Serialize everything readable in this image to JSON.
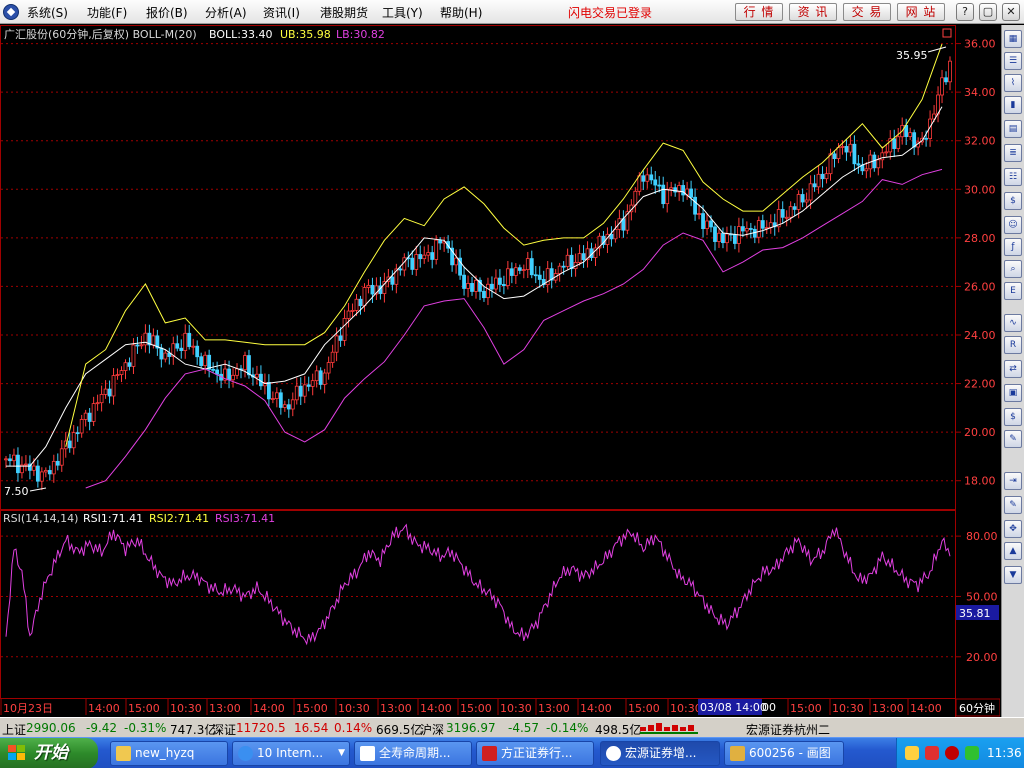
{
  "menu": {
    "items": [
      "系统(S)",
      "功能(F)",
      "报价(B)",
      "分析(A)",
      "资讯(I)",
      "港股期货",
      "工具(Y)",
      "帮助(H)"
    ],
    "login_status": "闪电交易已登录",
    "nav_buttons": [
      "行 情",
      "资 讯",
      "交 易",
      "网 站"
    ],
    "window_controls": [
      "?",
      "_",
      "▢",
      "✕"
    ]
  },
  "price_panel": {
    "title": "广汇股份(60分钟,后复权) BOLL-M(20)",
    "boll_label": "BOLL:33.40",
    "ub_label": "UB:35.98",
    "lb_label": "LB:30.82",
    "high_marker": "35.95",
    "low_marker": "7.50",
    "y_ticks": [
      "36.00",
      "34.00",
      "32.00",
      "30.00",
      "28.00",
      "26.00",
      "24.00",
      "22.00",
      "20.00",
      "18.00"
    ]
  },
  "rsi_panel": {
    "title": "RSI(14,14,14)",
    "rsi1_label": "RSI1:71.41",
    "rsi2_label": "RSI2:71.41",
    "rsi3_label": "RSI3:71.41",
    "y_ticks": [
      "80.00",
      "50.00",
      "20.00"
    ],
    "cursor_value": "35.81"
  },
  "x_axis": {
    "labels": [
      "10月23日",
      "14:00",
      "15:00",
      "10:30",
      "13:00",
      "14:00",
      "15:00",
      "10:30",
      "13:00",
      "14:00",
      "15:00",
      "10:30",
      "13:00",
      "14:00",
      "15:00",
      "10:30",
      "13:00",
      "14:00",
      "15:00",
      "10:30",
      "13:00",
      "14:00"
    ],
    "cursor_label": "03/08 14:00",
    "cursor_label_tail": "00",
    "period": "60分钟"
  },
  "statusbar": {
    "sh_label": "上证",
    "sh_value": "2990.06",
    "sh_change": "-9.42",
    "sh_pct": "-0.31%",
    "sh_amount": "747.3亿",
    "sz_label": "深证",
    "sz_value": "11720.5",
    "sz_change": "16.54",
    "sz_pct": "0.14%",
    "sz_amount": "669.5亿",
    "hs_label": "沪深",
    "hs_value": "3196.97",
    "hs_change": "-4.57",
    "hs_pct": "-0.14%",
    "hs_amount": "498.5亿",
    "broker": "宏源证券杭州二"
  },
  "taskbar": {
    "start": "开始",
    "tasks": [
      "new_hyzq",
      "10 Intern...",
      "全寿命周期...",
      "方正证券行...",
      "宏源证券增...",
      "600256 - 画图"
    ],
    "clock": "11:36"
  },
  "colors": {
    "up": "#ff3b3b",
    "down": "#40d0ff",
    "boll_mid": "#ffffff",
    "boll_upper": "#ffff40",
    "boll_lower": "#e040e0",
    "rsi": "#e040e0",
    "grid": "#a00000"
  },
  "chart_data": {
    "type": "candlestick",
    "price_ylim": [
      17.0,
      36.6
    ],
    "rsi_ylim": [
      0,
      92
    ],
    "boll_mid": [
      [
        0,
        18.6
      ],
      [
        12,
        18.6
      ],
      [
        20,
        19.4
      ],
      [
        30,
        21.0
      ],
      [
        40,
        22.4
      ],
      [
        50,
        23.0
      ],
      [
        60,
        23.6
      ],
      [
        70,
        23.7
      ],
      [
        80,
        23.4
      ],
      [
        90,
        22.8
      ],
      [
        100,
        22.6
      ],
      [
        110,
        22.8
      ],
      [
        120,
        22.5
      ],
      [
        130,
        22.0
      ],
      [
        140,
        22.1
      ],
      [
        150,
        22.4
      ],
      [
        160,
        23.6
      ],
      [
        170,
        24.4
      ],
      [
        180,
        25.2
      ],
      [
        190,
        26.1
      ],
      [
        200,
        27.0
      ],
      [
        210,
        28.0
      ],
      [
        220,
        27.9
      ],
      [
        230,
        26.8
      ],
      [
        240,
        26.0
      ],
      [
        250,
        25.5
      ],
      [
        260,
        25.6
      ],
      [
        270,
        26.1
      ],
      [
        280,
        26.6
      ],
      [
        290,
        27.0
      ],
      [
        300,
        27.8
      ],
      [
        310,
        28.8
      ],
      [
        320,
        29.7
      ],
      [
        330,
        30.0
      ],
      [
        340,
        29.9
      ],
      [
        350,
        29.2
      ],
      [
        360,
        28.2
      ],
      [
        370,
        28.1
      ],
      [
        380,
        28.3
      ],
      [
        390,
        28.6
      ],
      [
        400,
        29.1
      ],
      [
        410,
        29.8
      ],
      [
        420,
        30.5
      ],
      [
        430,
        31.0
      ],
      [
        440,
        31.3
      ],
      [
        450,
        31.4
      ],
      [
        460,
        32.0
      ],
      [
        470,
        33.4
      ]
    ],
    "boll_upper": [
      [
        30,
        19.4
      ],
      [
        40,
        22.8
      ],
      [
        50,
        23.4
      ],
      [
        60,
        25.0
      ],
      [
        70,
        26.1
      ],
      [
        80,
        24.5
      ],
      [
        90,
        24.7
      ],
      [
        100,
        23.8
      ],
      [
        110,
        23.8
      ],
      [
        120,
        23.7
      ],
      [
        130,
        23.6
      ],
      [
        140,
        23.6
      ],
      [
        150,
        23.6
      ],
      [
        160,
        24.1
      ],
      [
        170,
        25.2
      ],
      [
        180,
        26.6
      ],
      [
        190,
        27.9
      ],
      [
        200,
        28.8
      ],
      [
        210,
        28.5
      ],
      [
        220,
        29.6
      ],
      [
        230,
        30.1
      ],
      [
        240,
        29.4
      ],
      [
        250,
        28.4
      ],
      [
        260,
        27.7
      ],
      [
        270,
        27.9
      ],
      [
        280,
        28.0
      ],
      [
        290,
        28.0
      ],
      [
        300,
        28.6
      ],
      [
        310,
        29.6
      ],
      [
        320,
        30.8
      ],
      [
        330,
        31.9
      ],
      [
        340,
        31.6
      ],
      [
        350,
        30.3
      ],
      [
        360,
        29.6
      ],
      [
        370,
        29.1
      ],
      [
        380,
        29.1
      ],
      [
        390,
        29.8
      ],
      [
        400,
        30.5
      ],
      [
        410,
        31.1
      ],
      [
        420,
        31.9
      ],
      [
        430,
        32.7
      ],
      [
        440,
        31.7
      ],
      [
        450,
        32.4
      ],
      [
        460,
        33.7
      ],
      [
        470,
        35.98
      ]
    ],
    "boll_lower": [
      [
        40,
        17.7
      ],
      [
        50,
        18.0
      ],
      [
        60,
        19.0
      ],
      [
        70,
        20.1
      ],
      [
        80,
        21.4
      ],
      [
        90,
        22.4
      ],
      [
        100,
        22.6
      ],
      [
        110,
        22.2
      ],
      [
        120,
        21.9
      ],
      [
        130,
        21.3
      ],
      [
        140,
        20.0
      ],
      [
        150,
        19.6
      ],
      [
        160,
        20.1
      ],
      [
        170,
        21.4
      ],
      [
        180,
        22.2
      ],
      [
        190,
        22.9
      ],
      [
        200,
        24.0
      ],
      [
        210,
        25.2
      ],
      [
        220,
        25.4
      ],
      [
        230,
        25.5
      ],
      [
        240,
        24.3
      ],
      [
        250,
        22.8
      ],
      [
        260,
        23.4
      ],
      [
        270,
        24.6
      ],
      [
        280,
        25.0
      ],
      [
        290,
        25.4
      ],
      [
        300,
        25.7
      ],
      [
        310,
        26.1
      ],
      [
        320,
        26.7
      ],
      [
        330,
        27.7
      ],
      [
        340,
        28.2
      ],
      [
        350,
        27.9
      ],
      [
        360,
        26.6
      ],
      [
        370,
        27.0
      ],
      [
        380,
        27.5
      ],
      [
        390,
        27.6
      ],
      [
        400,
        28.0
      ],
      [
        410,
        28.5
      ],
      [
        420,
        29.0
      ],
      [
        430,
        29.5
      ],
      [
        440,
        30.4
      ],
      [
        450,
        30.2
      ],
      [
        460,
        30.6
      ],
      [
        470,
        30.82
      ]
    ],
    "close_path": [
      [
        0,
        18.9
      ],
      [
        20,
        18.2
      ],
      [
        40,
        20.6
      ],
      [
        55,
        22.2
      ],
      [
        70,
        24.0
      ],
      [
        80,
        23.1
      ],
      [
        90,
        23.8
      ],
      [
        100,
        22.8
      ],
      [
        110,
        22.2
      ],
      [
        120,
        22.8
      ],
      [
        130,
        21.8
      ],
      [
        140,
        21.0
      ],
      [
        150,
        21.9
      ],
      [
        160,
        22.4
      ],
      [
        170,
        24.6
      ],
      [
        180,
        25.8
      ],
      [
        190,
        26.0
      ],
      [
        200,
        27.0
      ],
      [
        210,
        27.2
      ],
      [
        220,
        27.9
      ],
      [
        230,
        26.1
      ],
      [
        240,
        25.8
      ],
      [
        250,
        26.3
      ],
      [
        260,
        26.9
      ],
      [
        270,
        26.2
      ],
      [
        280,
        26.9
      ],
      [
        290,
        27.2
      ],
      [
        300,
        27.9
      ],
      [
        310,
        28.6
      ],
      [
        320,
        30.7
      ],
      [
        330,
        29.8
      ],
      [
        340,
        30.1
      ],
      [
        350,
        28.6
      ],
      [
        360,
        27.9
      ],
      [
        370,
        28.3
      ],
      [
        380,
        28.4
      ],
      [
        390,
        28.9
      ],
      [
        400,
        29.6
      ],
      [
        410,
        30.6
      ],
      [
        420,
        31.9
      ],
      [
        430,
        30.8
      ],
      [
        440,
        31.4
      ],
      [
        450,
        32.4
      ],
      [
        460,
        31.8
      ],
      [
        470,
        34.3
      ],
      [
        474,
        35.2
      ]
    ],
    "rsi": [
      [
        0,
        30
      ],
      [
        4,
        74
      ],
      [
        8,
        62
      ],
      [
        12,
        30
      ],
      [
        18,
        52
      ],
      [
        24,
        66
      ],
      [
        30,
        78
      ],
      [
        36,
        72
      ],
      [
        42,
        76
      ],
      [
        48,
        72
      ],
      [
        54,
        82
      ],
      [
        60,
        74
      ],
      [
        66,
        78
      ],
      [
        72,
        68
      ],
      [
        78,
        60
      ],
      [
        84,
        56
      ],
      [
        90,
        60
      ],
      [
        96,
        60
      ],
      [
        102,
        55
      ],
      [
        108,
        52
      ],
      [
        114,
        54
      ],
      [
        120,
        50
      ],
      [
        126,
        54
      ],
      [
        132,
        48
      ],
      [
        140,
        38
      ],
      [
        146,
        32
      ],
      [
        152,
        28
      ],
      [
        158,
        34
      ],
      [
        164,
        44
      ],
      [
        170,
        56
      ],
      [
        176,
        62
      ],
      [
        182,
        72
      ],
      [
        188,
        68
      ],
      [
        194,
        80
      ],
      [
        200,
        84
      ],
      [
        206,
        76
      ],
      [
        212,
        74
      ],
      [
        218,
        70
      ],
      [
        224,
        72
      ],
      [
        230,
        64
      ],
      [
        236,
        56
      ],
      [
        242,
        52
      ],
      [
        248,
        46
      ],
      [
        254,
        34
      ],
      [
        260,
        30
      ],
      [
        266,
        36
      ],
      [
        272,
        48
      ],
      [
        278,
        60
      ],
      [
        284,
        64
      ],
      [
        290,
        60
      ],
      [
        296,
        64
      ],
      [
        302,
        70
      ],
      [
        308,
        78
      ],
      [
        314,
        82
      ],
      [
        320,
        74
      ],
      [
        326,
        80
      ],
      [
        332,
        70
      ],
      [
        338,
        60
      ],
      [
        344,
        56
      ],
      [
        350,
        48
      ],
      [
        356,
        40
      ],
      [
        362,
        36
      ],
      [
        368,
        44
      ],
      [
        374,
        54
      ],
      [
        380,
        62
      ],
      [
        386,
        64
      ],
      [
        392,
        72
      ],
      [
        398,
        78
      ],
      [
        404,
        68
      ],
      [
        410,
        72
      ],
      [
        416,
        84
      ],
      [
        422,
        70
      ],
      [
        428,
        58
      ],
      [
        434,
        60
      ],
      [
        440,
        70
      ],
      [
        446,
        64
      ],
      [
        452,
        58
      ],
      [
        458,
        56
      ],
      [
        464,
        62
      ],
      [
        470,
        78
      ],
      [
        474,
        70
      ]
    ]
  }
}
